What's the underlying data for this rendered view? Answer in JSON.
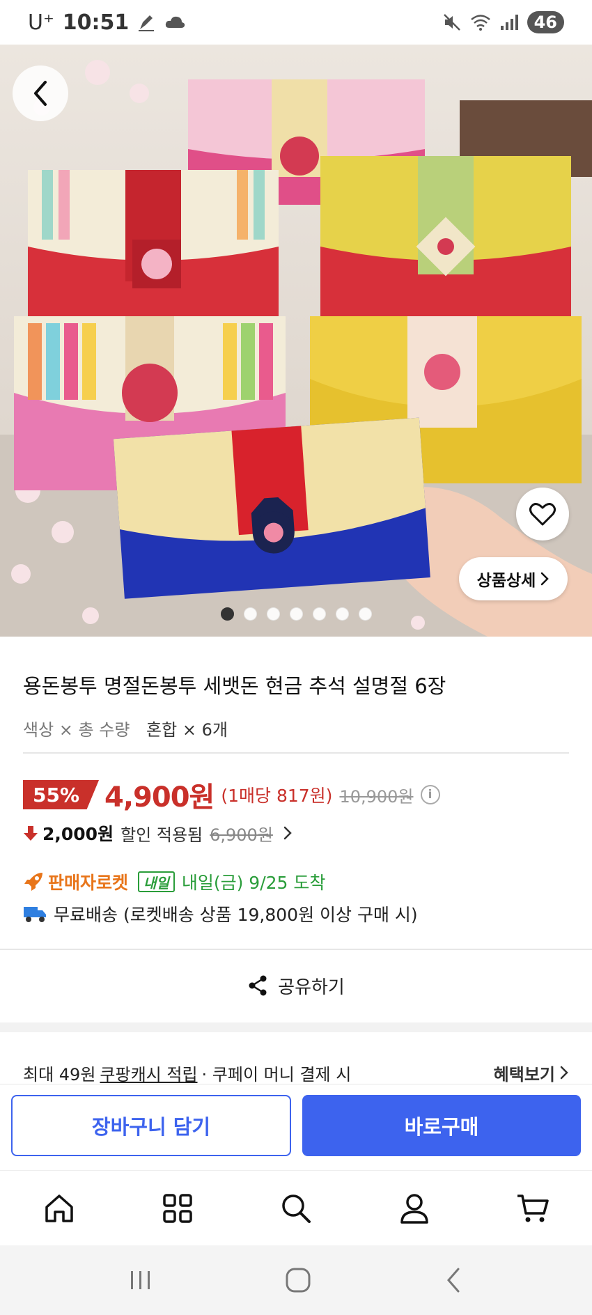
{
  "status_bar": {
    "carrier": "U⁺",
    "time": "10:51",
    "battery": "46"
  },
  "hero": {
    "detail_label": "상품상세",
    "image_count": 7,
    "active_index": 0
  },
  "product": {
    "title": "용돈봉투 명절돈봉투 세뱃돈 현금 추석 설명절 6장",
    "option_label": "색상 × 총 수량",
    "option_value": "혼합 × 6개",
    "discount_rate": "55%",
    "price": "4,900원",
    "unit_price": "(1매당 817원)",
    "original_price": "10,900원",
    "coupon_amount": "2,000원",
    "coupon_text": "할인 적용됨",
    "coupon_original": "6,900원"
  },
  "delivery": {
    "rocket_label": "판매자로켓",
    "tomorrow_badge": "내일",
    "arrival": "내일(금) 9/25 도착",
    "shipping": "무료배송 (로켓배송 상품 19,800원 이상 구매 시)"
  },
  "share": {
    "label": "공유하기"
  },
  "cash": {
    "prefix": "최대 49원",
    "link": "쿠팡캐시 적립",
    "suffix": "· 쿠페이 머니 결제 시",
    "benefit_label": "혜택보기"
  },
  "actions": {
    "cart_label": "장바구니 담기",
    "buy_label": "바로구매"
  },
  "tabs": [
    "home-icon",
    "category-icon",
    "search-icon",
    "my-page-icon",
    "cart-icon"
  ],
  "colors": {
    "accent": "#3d63ee",
    "sale_red": "#c9302a",
    "rocket_orange": "#e8751a",
    "arrival_green": "#2a9d3a"
  }
}
